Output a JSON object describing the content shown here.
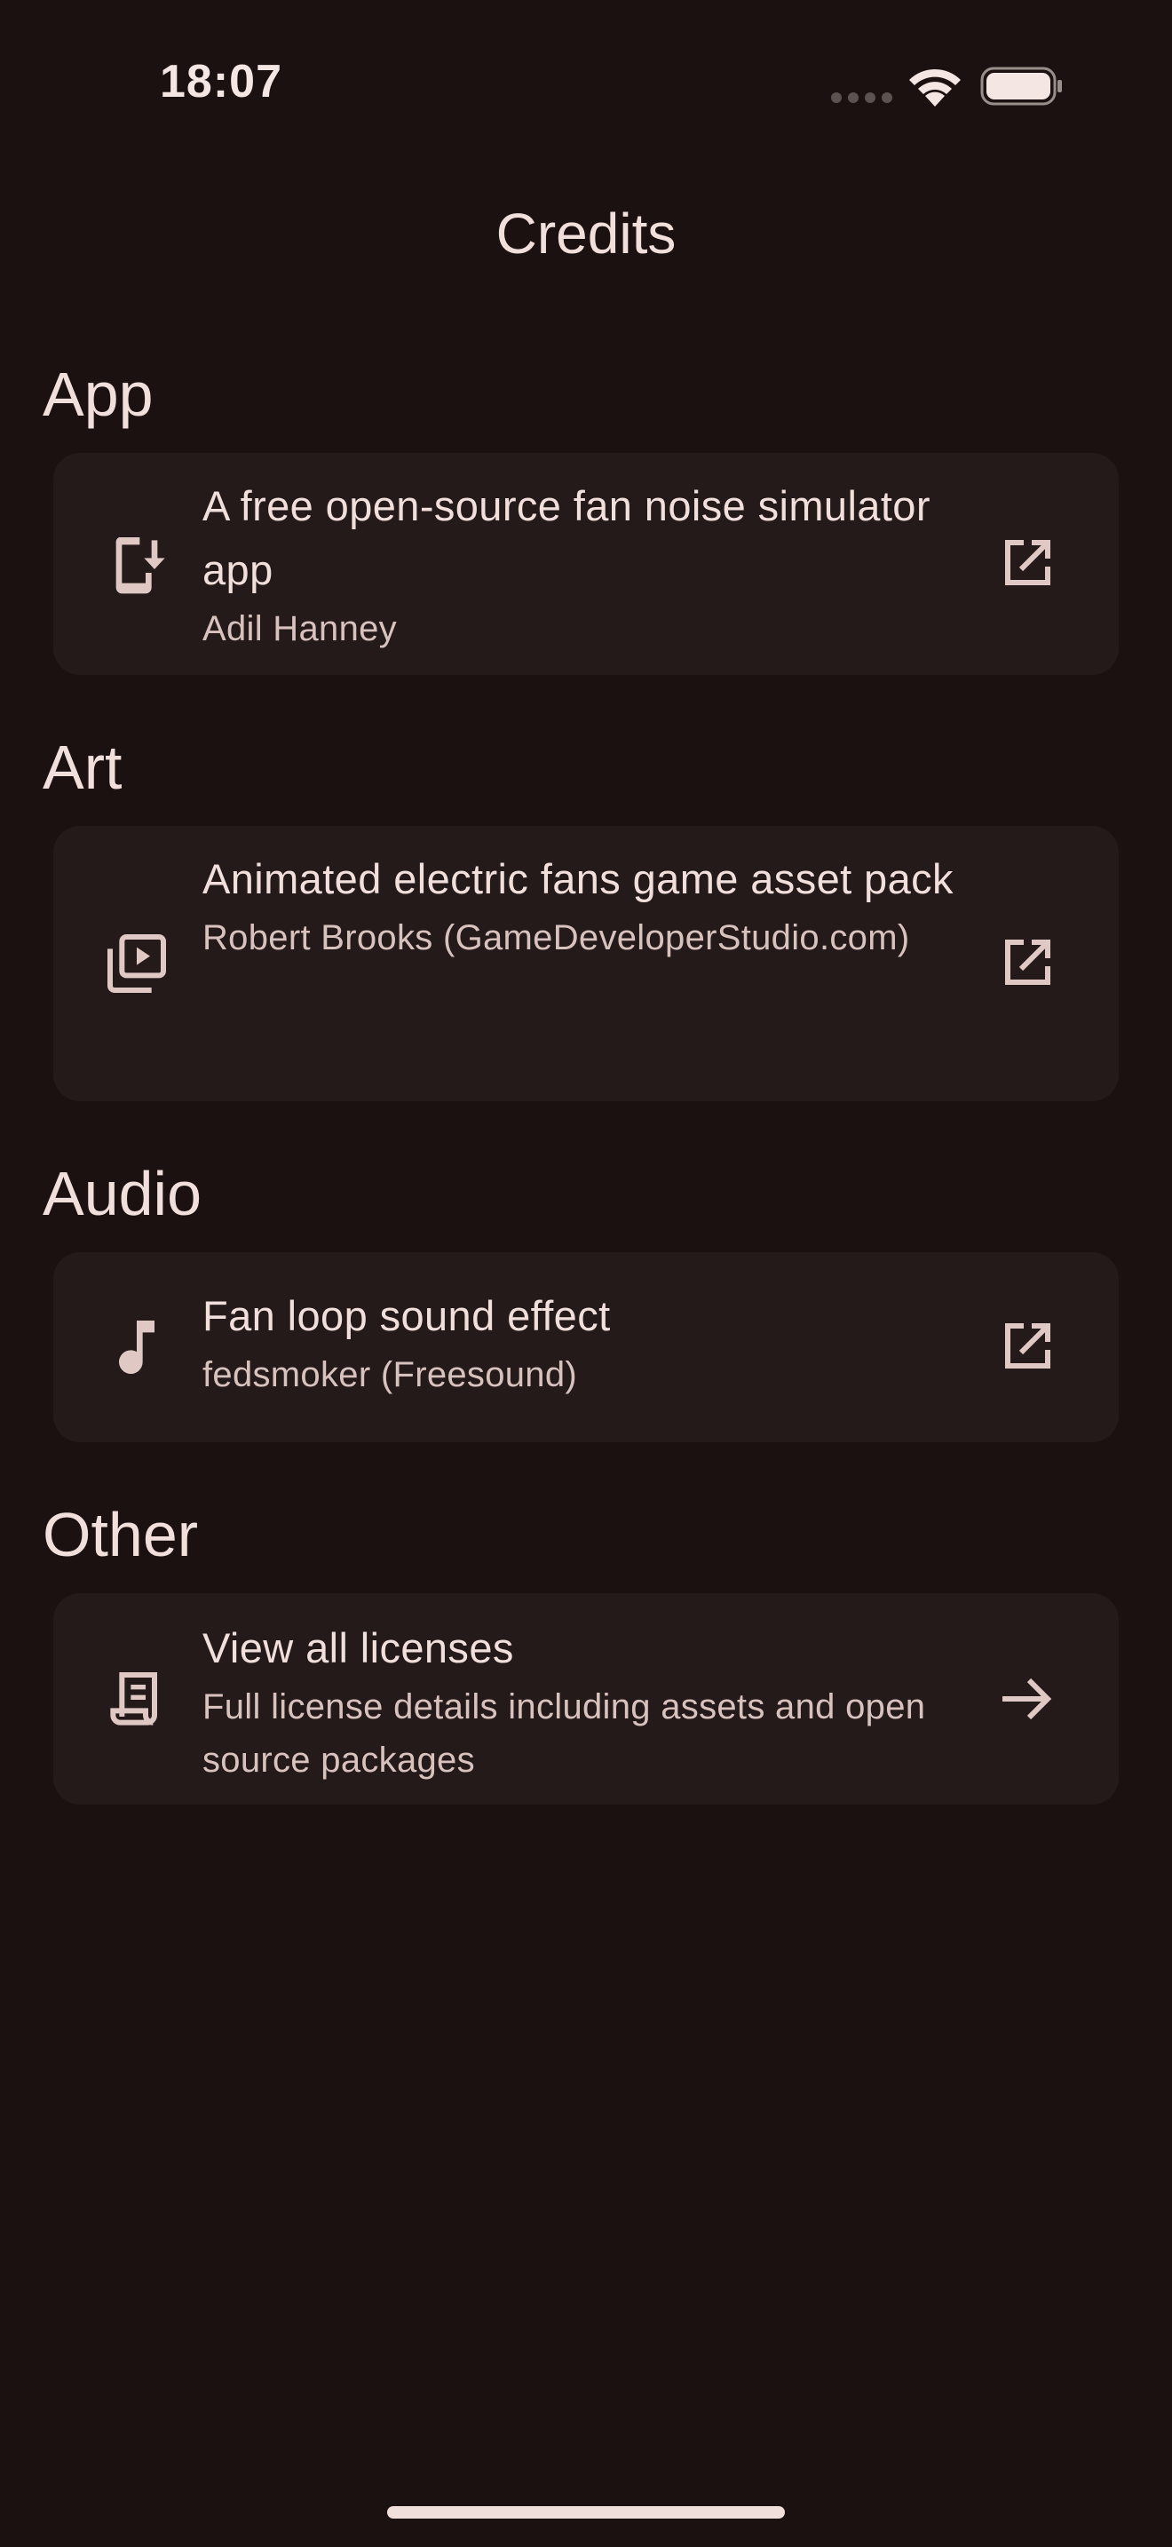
{
  "status_bar": {
    "time": "18:07"
  },
  "app_bar": {
    "title": "Credits"
  },
  "sections": [
    {
      "header": "App",
      "item": {
        "icon": "phone-download-icon",
        "title": "A free open-source fan noise simulator app",
        "subtitle": "Adil Hanney",
        "trailing_icon": "open-in-new-icon"
      }
    },
    {
      "header": "Art",
      "item": {
        "icon": "video-library-icon",
        "title": "Animated electric fans game asset pack",
        "subtitle": "Robert Brooks (GameDeveloperStudio.com)",
        "trailing_icon": "open-in-new-icon"
      }
    },
    {
      "header": "Audio",
      "item": {
        "icon": "music-note-icon",
        "title": "Fan loop sound effect",
        "subtitle": "fedsmoker (Freesound)",
        "trailing_icon": "open-in-new-icon"
      }
    },
    {
      "header": "Other",
      "item": {
        "icon": "license-document-icon",
        "title": "View all licenses",
        "subtitle": "Full license details including assets and open source packages",
        "trailing_icon": "arrow-forward-icon"
      }
    }
  ],
  "colors": {
    "background": "#1a1110",
    "card": "#231a19",
    "text_primary": "#f1dfdb",
    "text_secondary": "#d8c2be",
    "icon": "#e0c8c4"
  }
}
